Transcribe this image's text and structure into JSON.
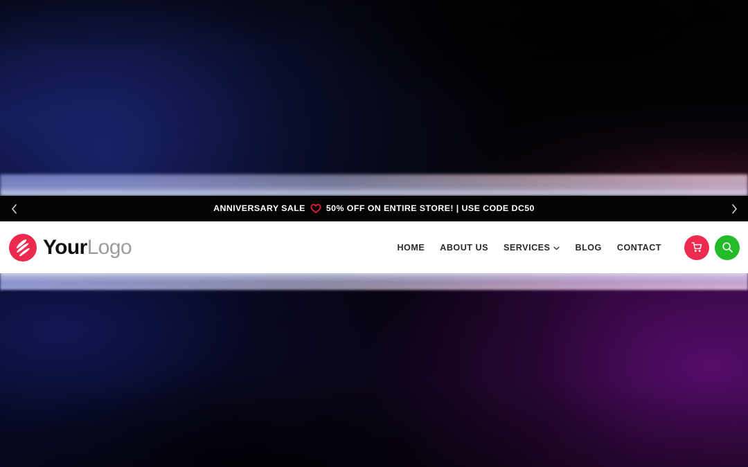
{
  "announcement": {
    "text": "ANNIVERSARY SALE",
    "text_after": "50% OFF ON ENTIRE STORE! | USE CODE DC50",
    "heart_icon": "heart-outline-icon",
    "prev_icon": "chevron-left-icon",
    "next_icon": "chevron-right-icon",
    "background": "#040404",
    "text_color": "#ffffff",
    "heart_color": "#e01b37"
  },
  "header": {
    "background": "#ffffff",
    "logo": {
      "mark_icon": "lightning-circle-logo-icon",
      "mark_color": "#ec2a4e",
      "word_bold": "Your",
      "word_light": "Logo",
      "bold_color": "#111111",
      "light_color": "#9c9c9c"
    },
    "nav": [
      {
        "label": "HOME",
        "has_dropdown": false
      },
      {
        "label": "ABOUT US",
        "has_dropdown": false
      },
      {
        "label": "SERVICES",
        "has_dropdown": true,
        "caret_icon": "chevron-down-icon"
      },
      {
        "label": "BLOG",
        "has_dropdown": false
      },
      {
        "label": "CONTACT",
        "has_dropdown": false
      }
    ],
    "actions": {
      "cart": {
        "icon": "shopping-cart-icon",
        "color": "#ee2a4f"
      },
      "search": {
        "icon": "magnifier-icon",
        "color": "#23bb28"
      }
    }
  },
  "hero": {
    "top_colors": [
      "#070a22",
      "#040410",
      "#050208"
    ],
    "bottom_colors": [
      "#050823",
      "#0a0418",
      "#330a3e"
    ],
    "glow_color": "#d6d8ea"
  }
}
